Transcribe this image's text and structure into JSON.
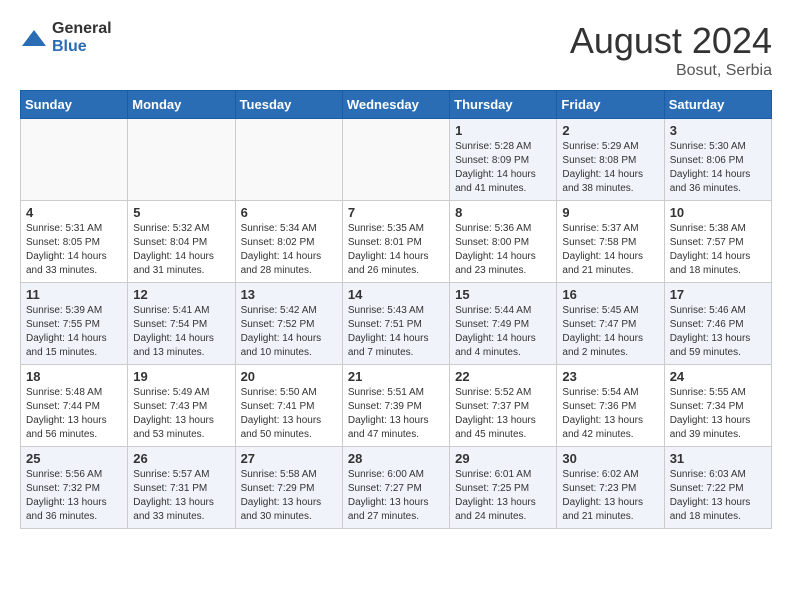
{
  "header": {
    "logo_general": "General",
    "logo_blue": "Blue",
    "month_year": "August 2024",
    "location": "Bosut, Serbia"
  },
  "weekdays": [
    "Sunday",
    "Monday",
    "Tuesday",
    "Wednesday",
    "Thursday",
    "Friday",
    "Saturday"
  ],
  "weeks": [
    [
      {
        "day": "",
        "info": ""
      },
      {
        "day": "",
        "info": ""
      },
      {
        "day": "",
        "info": ""
      },
      {
        "day": "",
        "info": ""
      },
      {
        "day": "1",
        "info": "Sunrise: 5:28 AM\nSunset: 8:09 PM\nDaylight: 14 hours\nand 41 minutes."
      },
      {
        "day": "2",
        "info": "Sunrise: 5:29 AM\nSunset: 8:08 PM\nDaylight: 14 hours\nand 38 minutes."
      },
      {
        "day": "3",
        "info": "Sunrise: 5:30 AM\nSunset: 8:06 PM\nDaylight: 14 hours\nand 36 minutes."
      }
    ],
    [
      {
        "day": "4",
        "info": "Sunrise: 5:31 AM\nSunset: 8:05 PM\nDaylight: 14 hours\nand 33 minutes."
      },
      {
        "day": "5",
        "info": "Sunrise: 5:32 AM\nSunset: 8:04 PM\nDaylight: 14 hours\nand 31 minutes."
      },
      {
        "day": "6",
        "info": "Sunrise: 5:34 AM\nSunset: 8:02 PM\nDaylight: 14 hours\nand 28 minutes."
      },
      {
        "day": "7",
        "info": "Sunrise: 5:35 AM\nSunset: 8:01 PM\nDaylight: 14 hours\nand 26 minutes."
      },
      {
        "day": "8",
        "info": "Sunrise: 5:36 AM\nSunset: 8:00 PM\nDaylight: 14 hours\nand 23 minutes."
      },
      {
        "day": "9",
        "info": "Sunrise: 5:37 AM\nSunset: 7:58 PM\nDaylight: 14 hours\nand 21 minutes."
      },
      {
        "day": "10",
        "info": "Sunrise: 5:38 AM\nSunset: 7:57 PM\nDaylight: 14 hours\nand 18 minutes."
      }
    ],
    [
      {
        "day": "11",
        "info": "Sunrise: 5:39 AM\nSunset: 7:55 PM\nDaylight: 14 hours\nand 15 minutes."
      },
      {
        "day": "12",
        "info": "Sunrise: 5:41 AM\nSunset: 7:54 PM\nDaylight: 14 hours\nand 13 minutes."
      },
      {
        "day": "13",
        "info": "Sunrise: 5:42 AM\nSunset: 7:52 PM\nDaylight: 14 hours\nand 10 minutes."
      },
      {
        "day": "14",
        "info": "Sunrise: 5:43 AM\nSunset: 7:51 PM\nDaylight: 14 hours\nand 7 minutes."
      },
      {
        "day": "15",
        "info": "Sunrise: 5:44 AM\nSunset: 7:49 PM\nDaylight: 14 hours\nand 4 minutes."
      },
      {
        "day": "16",
        "info": "Sunrise: 5:45 AM\nSunset: 7:47 PM\nDaylight: 14 hours\nand 2 minutes."
      },
      {
        "day": "17",
        "info": "Sunrise: 5:46 AM\nSunset: 7:46 PM\nDaylight: 13 hours\nand 59 minutes."
      }
    ],
    [
      {
        "day": "18",
        "info": "Sunrise: 5:48 AM\nSunset: 7:44 PM\nDaylight: 13 hours\nand 56 minutes."
      },
      {
        "day": "19",
        "info": "Sunrise: 5:49 AM\nSunset: 7:43 PM\nDaylight: 13 hours\nand 53 minutes."
      },
      {
        "day": "20",
        "info": "Sunrise: 5:50 AM\nSunset: 7:41 PM\nDaylight: 13 hours\nand 50 minutes."
      },
      {
        "day": "21",
        "info": "Sunrise: 5:51 AM\nSunset: 7:39 PM\nDaylight: 13 hours\nand 47 minutes."
      },
      {
        "day": "22",
        "info": "Sunrise: 5:52 AM\nSunset: 7:37 PM\nDaylight: 13 hours\nand 45 minutes."
      },
      {
        "day": "23",
        "info": "Sunrise: 5:54 AM\nSunset: 7:36 PM\nDaylight: 13 hours\nand 42 minutes."
      },
      {
        "day": "24",
        "info": "Sunrise: 5:55 AM\nSunset: 7:34 PM\nDaylight: 13 hours\nand 39 minutes."
      }
    ],
    [
      {
        "day": "25",
        "info": "Sunrise: 5:56 AM\nSunset: 7:32 PM\nDaylight: 13 hours\nand 36 minutes."
      },
      {
        "day": "26",
        "info": "Sunrise: 5:57 AM\nSunset: 7:31 PM\nDaylight: 13 hours\nand 33 minutes."
      },
      {
        "day": "27",
        "info": "Sunrise: 5:58 AM\nSunset: 7:29 PM\nDaylight: 13 hours\nand 30 minutes."
      },
      {
        "day": "28",
        "info": "Sunrise: 6:00 AM\nSunset: 7:27 PM\nDaylight: 13 hours\nand 27 minutes."
      },
      {
        "day": "29",
        "info": "Sunrise: 6:01 AM\nSunset: 7:25 PM\nDaylight: 13 hours\nand 24 minutes."
      },
      {
        "day": "30",
        "info": "Sunrise: 6:02 AM\nSunset: 7:23 PM\nDaylight: 13 hours\nand 21 minutes."
      },
      {
        "day": "31",
        "info": "Sunrise: 6:03 AM\nSunset: 7:22 PM\nDaylight: 13 hours\nand 18 minutes."
      }
    ]
  ]
}
